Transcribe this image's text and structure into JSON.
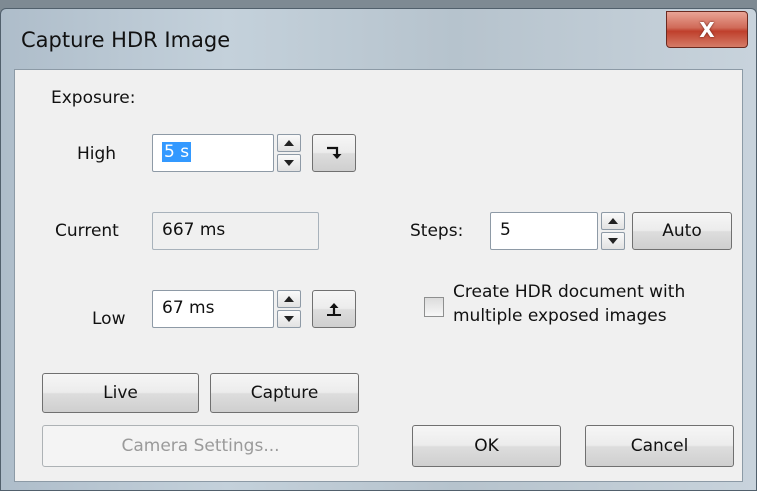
{
  "window": {
    "title": "Capture HDR Image",
    "close_glyph": "X"
  },
  "exposure": {
    "group_label": "Exposure:",
    "high_label": "High",
    "high_value": "5 s",
    "current_label": "Current",
    "current_value": "667 ms",
    "low_label": "Low",
    "low_value": "67 ms"
  },
  "steps": {
    "label": "Steps:",
    "value": "5",
    "auto_label": "Auto"
  },
  "hdr_option": {
    "line1": "Create HDR document with",
    "line2": "multiple exposed images",
    "checked": false
  },
  "buttons": {
    "live": "Live",
    "capture": "Capture",
    "camera_settings": "Camera Settings...",
    "ok": "OK",
    "cancel": "Cancel"
  },
  "icons": {
    "set_high": "arrow-turn-down-icon",
    "set_low": "arrow-turn-up-icon"
  }
}
